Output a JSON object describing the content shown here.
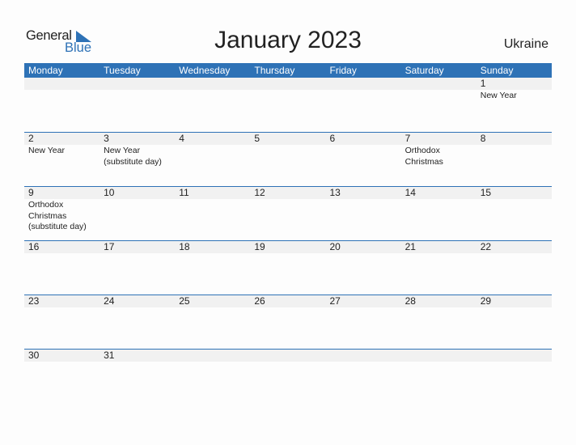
{
  "logo": {
    "line1": "General",
    "line2": "Blue"
  },
  "title": "January 2023",
  "country": "Ukraine",
  "colors": {
    "accent": "#2e72b6",
    "band": "#f1f1f1"
  },
  "weekdays": [
    "Monday",
    "Tuesday",
    "Wednesday",
    "Thursday",
    "Friday",
    "Saturday",
    "Sunday"
  ],
  "weeks": [
    [
      {
        "d": "",
        "h": ""
      },
      {
        "d": "",
        "h": ""
      },
      {
        "d": "",
        "h": ""
      },
      {
        "d": "",
        "h": ""
      },
      {
        "d": "",
        "h": ""
      },
      {
        "d": "",
        "h": ""
      },
      {
        "d": "1",
        "h": "New Year"
      }
    ],
    [
      {
        "d": "2",
        "h": "New Year"
      },
      {
        "d": "3",
        "h": "New Year\n(substitute day)"
      },
      {
        "d": "4",
        "h": ""
      },
      {
        "d": "5",
        "h": ""
      },
      {
        "d": "6",
        "h": ""
      },
      {
        "d": "7",
        "h": "Orthodox\nChristmas"
      },
      {
        "d": "8",
        "h": ""
      }
    ],
    [
      {
        "d": "9",
        "h": "Orthodox\nChristmas\n(substitute day)"
      },
      {
        "d": "10",
        "h": ""
      },
      {
        "d": "11",
        "h": ""
      },
      {
        "d": "12",
        "h": ""
      },
      {
        "d": "13",
        "h": ""
      },
      {
        "d": "14",
        "h": ""
      },
      {
        "d": "15",
        "h": ""
      }
    ],
    [
      {
        "d": "16",
        "h": ""
      },
      {
        "d": "17",
        "h": ""
      },
      {
        "d": "18",
        "h": ""
      },
      {
        "d": "19",
        "h": ""
      },
      {
        "d": "20",
        "h": ""
      },
      {
        "d": "21",
        "h": ""
      },
      {
        "d": "22",
        "h": ""
      }
    ],
    [
      {
        "d": "23",
        "h": ""
      },
      {
        "d": "24",
        "h": ""
      },
      {
        "d": "25",
        "h": ""
      },
      {
        "d": "26",
        "h": ""
      },
      {
        "d": "27",
        "h": ""
      },
      {
        "d": "28",
        "h": ""
      },
      {
        "d": "29",
        "h": ""
      }
    ],
    [
      {
        "d": "30",
        "h": ""
      },
      {
        "d": "31",
        "h": ""
      },
      {
        "d": "",
        "h": ""
      },
      {
        "d": "",
        "h": ""
      },
      {
        "d": "",
        "h": ""
      },
      {
        "d": "",
        "h": ""
      },
      {
        "d": "",
        "h": ""
      }
    ]
  ]
}
